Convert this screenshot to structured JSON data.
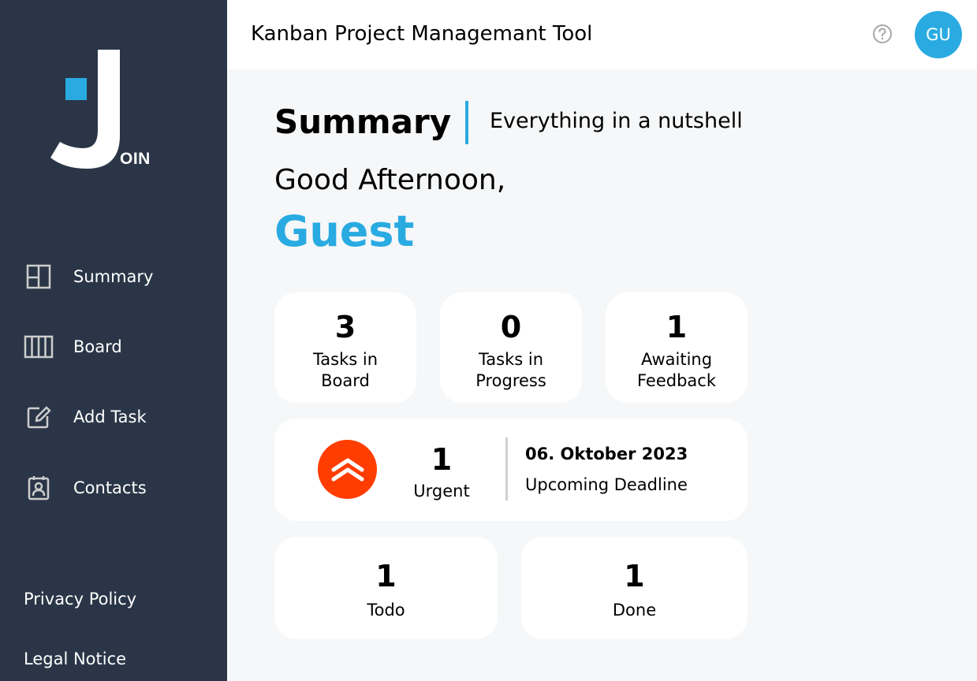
{
  "header": {
    "title": "Kanban Project Managemant Tool",
    "avatar_initials": "GU",
    "help_icon": "help-circle-icon"
  },
  "sidebar": {
    "logo_text": "OIN",
    "items": [
      {
        "label": "Summary",
        "icon": "summary-icon"
      },
      {
        "label": "Board",
        "icon": "board-icon"
      },
      {
        "label": "Add Task",
        "icon": "edit-icon"
      },
      {
        "label": "Contacts",
        "icon": "contacts-icon"
      }
    ],
    "footer": {
      "privacy": "Privacy Policy",
      "legal": "Legal Notice"
    }
  },
  "main": {
    "title": "Summary",
    "subtitle": "Everything in a nutshell",
    "greeting": "Good Afternoon,",
    "user_name": "Guest",
    "metrics": {
      "tasks_in_board": {
        "value": "3",
        "label_line1": "Tasks in",
        "label_line2": "Board"
      },
      "tasks_in_progress": {
        "value": "0",
        "label_line1": "Tasks in",
        "label_line2": "Progress"
      },
      "awaiting_feedback": {
        "value": "1",
        "label_line1": "Awaiting",
        "label_line2": "Feedback"
      }
    },
    "urgent": {
      "value": "1",
      "label": "Urgent",
      "icon": "double-chevron-up-icon"
    },
    "deadline": {
      "date": "06. Oktober 2023",
      "label": "Upcoming Deadline"
    },
    "todo": {
      "value": "1",
      "label": "Todo"
    },
    "done": {
      "value": "1",
      "label": "Done"
    }
  },
  "colors": {
    "sidebar_bg": "#2a3647",
    "accent": "#29abe2",
    "urgent": "#ff3d00",
    "page_bg": "#f6f7f8"
  }
}
